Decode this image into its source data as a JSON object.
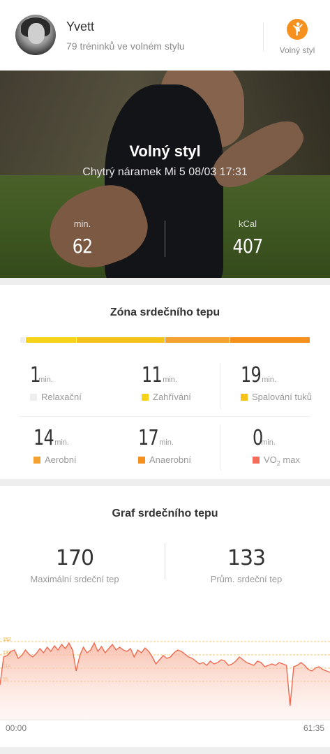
{
  "header": {
    "user_name": "Yvett",
    "user_subtitle": "79 tréninků ve volném stylu",
    "activity_label": "Volný styl",
    "accent_color": "#f6901e"
  },
  "hero": {
    "title": "Volný styl",
    "subtitle": "Chytrý náramek Mi 5 08/03 17:31",
    "stats": [
      {
        "label": "min.",
        "value": "62"
      },
      {
        "label": "kCal",
        "value": "407"
      }
    ]
  },
  "zones": {
    "title": "Zóna srdečního tepu",
    "unit": "min.",
    "items": [
      {
        "value": "1",
        "label": "Relaxační",
        "color": "#eeeeee"
      },
      {
        "value": "11",
        "label": "Zahřívání",
        "color": "#f7d21b"
      },
      {
        "value": "19",
        "label": "Spalování tuků",
        "color": "#f5c21a"
      },
      {
        "value": "14",
        "label": "Aerobní",
        "color": "#f3a232"
      },
      {
        "value": "17",
        "label": "Anaerobní",
        "color": "#f5901e"
      },
      {
        "value": "0",
        "label": "VO",
        "label_sub": "2",
        "label_suffix": " max",
        "color": "#f36b5b"
      }
    ]
  },
  "hr_graph": {
    "title": "Graf srdečního tepu",
    "stats": [
      {
        "value": "170",
        "label": "Maximální srdeční tep"
      },
      {
        "value": "133",
        "label": "Prům. srdeční tep"
      }
    ],
    "thresholds": [
      "152",
      "133",
      "114",
      "95"
    ],
    "time_start": "00:00",
    "time_end": "61:35",
    "line_color": "#ef6a4f"
  },
  "chart_data": {
    "type": "area",
    "title": "Graf srdečního tepu",
    "xlabel": "",
    "ylabel": "",
    "x_range": [
      "00:00",
      "61:35"
    ],
    "y_reference_lines": [
      152,
      133,
      114,
      95
    ],
    "series": [
      {
        "values": [
          90,
          130,
          132,
          138,
          140,
          128,
          132,
          140,
          134,
          130,
          135,
          142,
          136,
          144,
          138,
          146,
          140,
          148,
          142,
          150,
          140,
          110,
          132,
          144,
          136,
          140,
          150,
          138,
          145,
          136,
          142,
          148,
          140,
          144,
          140,
          138,
          142,
          130,
          140,
          136,
          143,
          138,
          130,
          120,
          126,
          132,
          128,
          130,
          136,
          140,
          138,
          134,
          130,
          128,
          124,
          120,
          122,
          118,
          124,
          120,
          122,
          126,
          124,
          118,
          120,
          124,
          130,
          126,
          122,
          120,
          118,
          124,
          122,
          116,
          118,
          120,
          118,
          122,
          120,
          118,
          60,
          116,
          118,
          122,
          118,
          112,
          110,
          114,
          116,
          112,
          110,
          108
        ]
      }
    ]
  }
}
